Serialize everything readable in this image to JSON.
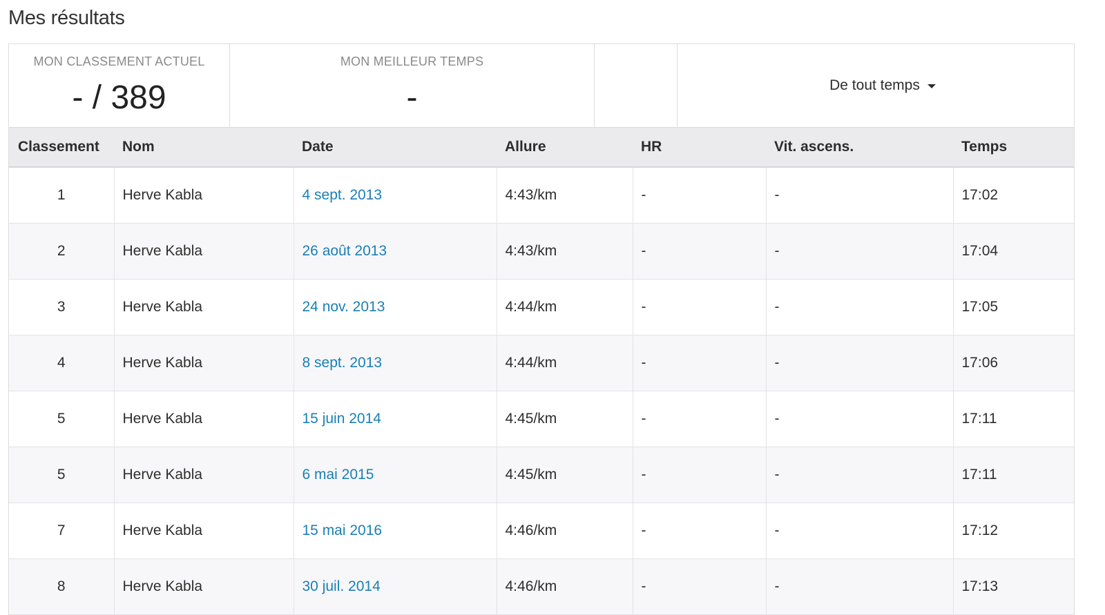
{
  "page": {
    "title": "Mes résultats"
  },
  "summary": {
    "rank_label": "MON CLASSEMENT ACTUEL",
    "rank_value": "- / 389",
    "best_label": "MON MEILLEUR TEMPS",
    "best_value": "-",
    "filter_label": "De tout temps"
  },
  "table": {
    "headers": [
      "Classement",
      "Nom",
      "Date",
      "Allure",
      "HR",
      "Vit. ascens.",
      "Temps"
    ],
    "rows": [
      {
        "rank": "1",
        "name": "Herve Kabla",
        "date": "4 sept. 2013",
        "pace": "4:43/km",
        "hr": "-",
        "vam": "-",
        "time": "17:02"
      },
      {
        "rank": "2",
        "name": "Herve Kabla",
        "date": "26 août 2013",
        "pace": "4:43/km",
        "hr": "-",
        "vam": "-",
        "time": "17:04"
      },
      {
        "rank": "3",
        "name": "Herve Kabla",
        "date": "24 nov. 2013",
        "pace": "4:44/km",
        "hr": "-",
        "vam": "-",
        "time": "17:05"
      },
      {
        "rank": "4",
        "name": "Herve Kabla",
        "date": "8 sept. 2013",
        "pace": "4:44/km",
        "hr": "-",
        "vam": "-",
        "time": "17:06"
      },
      {
        "rank": "5",
        "name": "Herve Kabla",
        "date": "15 juin 2014",
        "pace": "4:45/km",
        "hr": "-",
        "vam": "-",
        "time": "17:11"
      },
      {
        "rank": "5",
        "name": "Herve Kabla",
        "date": "6 mai 2015",
        "pace": "4:45/km",
        "hr": "-",
        "vam": "-",
        "time": "17:11"
      },
      {
        "rank": "7",
        "name": "Herve Kabla",
        "date": "15 mai 2016",
        "pace": "4:46/km",
        "hr": "-",
        "vam": "-",
        "time": "17:12"
      },
      {
        "rank": "8",
        "name": "Herve Kabla",
        "date": "30 juil. 2014",
        "pace": "4:46/km",
        "hr": "-",
        "vam": "-",
        "time": "17:13"
      }
    ]
  },
  "colors": {
    "link": "#1a7fb5",
    "header_bg": "#ebebee",
    "stripe_bg": "#f7f7f9",
    "border": "#dcdcdc"
  },
  "icons": {
    "filter_caret": "caret-down-icon"
  }
}
